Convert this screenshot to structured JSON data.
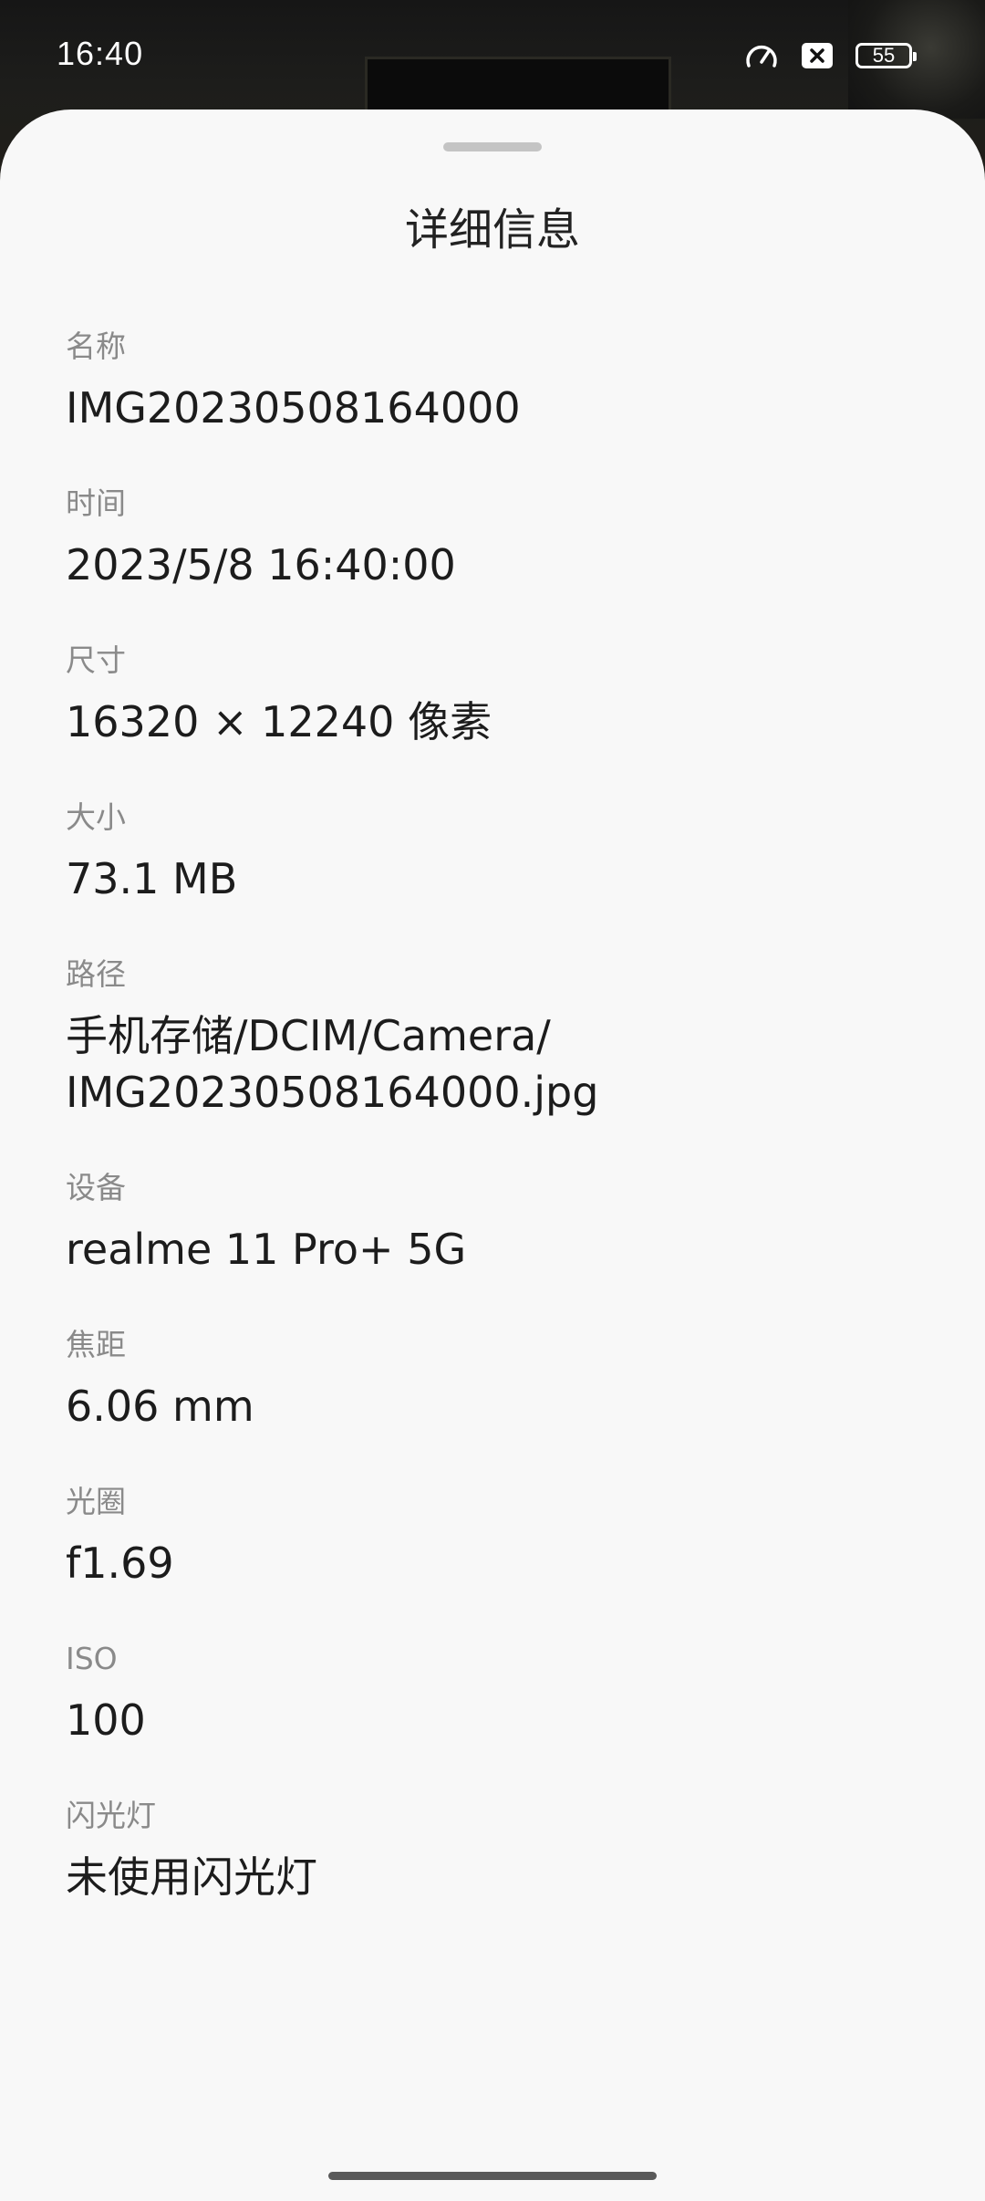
{
  "status_bar": {
    "time": "16:40",
    "battery": "55",
    "icons": [
      "speed-icon",
      "close-box-icon",
      "battery-icon"
    ]
  },
  "sheet": {
    "title": "详细信息",
    "items": [
      {
        "label": "名称",
        "value": "IMG20230508164000"
      },
      {
        "label": "时间",
        "value": "2023/5/8 16:40:00"
      },
      {
        "label": "尺寸",
        "value": "16320 × 12240 像素"
      },
      {
        "label": "大小",
        "value": "73.1 MB"
      },
      {
        "label": "路径",
        "value": "手机存储/DCIM/Camera/\nIMG20230508164000.jpg"
      },
      {
        "label": "设备",
        "value": "realme 11 Pro+ 5G"
      },
      {
        "label": "焦距",
        "value": "6.06 mm"
      },
      {
        "label": "光圈",
        "value": "f1.69"
      },
      {
        "label": "ISO",
        "value": "100"
      },
      {
        "label": "闪光灯",
        "value": "未使用闪光灯"
      }
    ]
  },
  "colors": {
    "sheet_background": "#f8f8f8",
    "label": "#8a8a8a",
    "value": "#1c1c1c"
  }
}
